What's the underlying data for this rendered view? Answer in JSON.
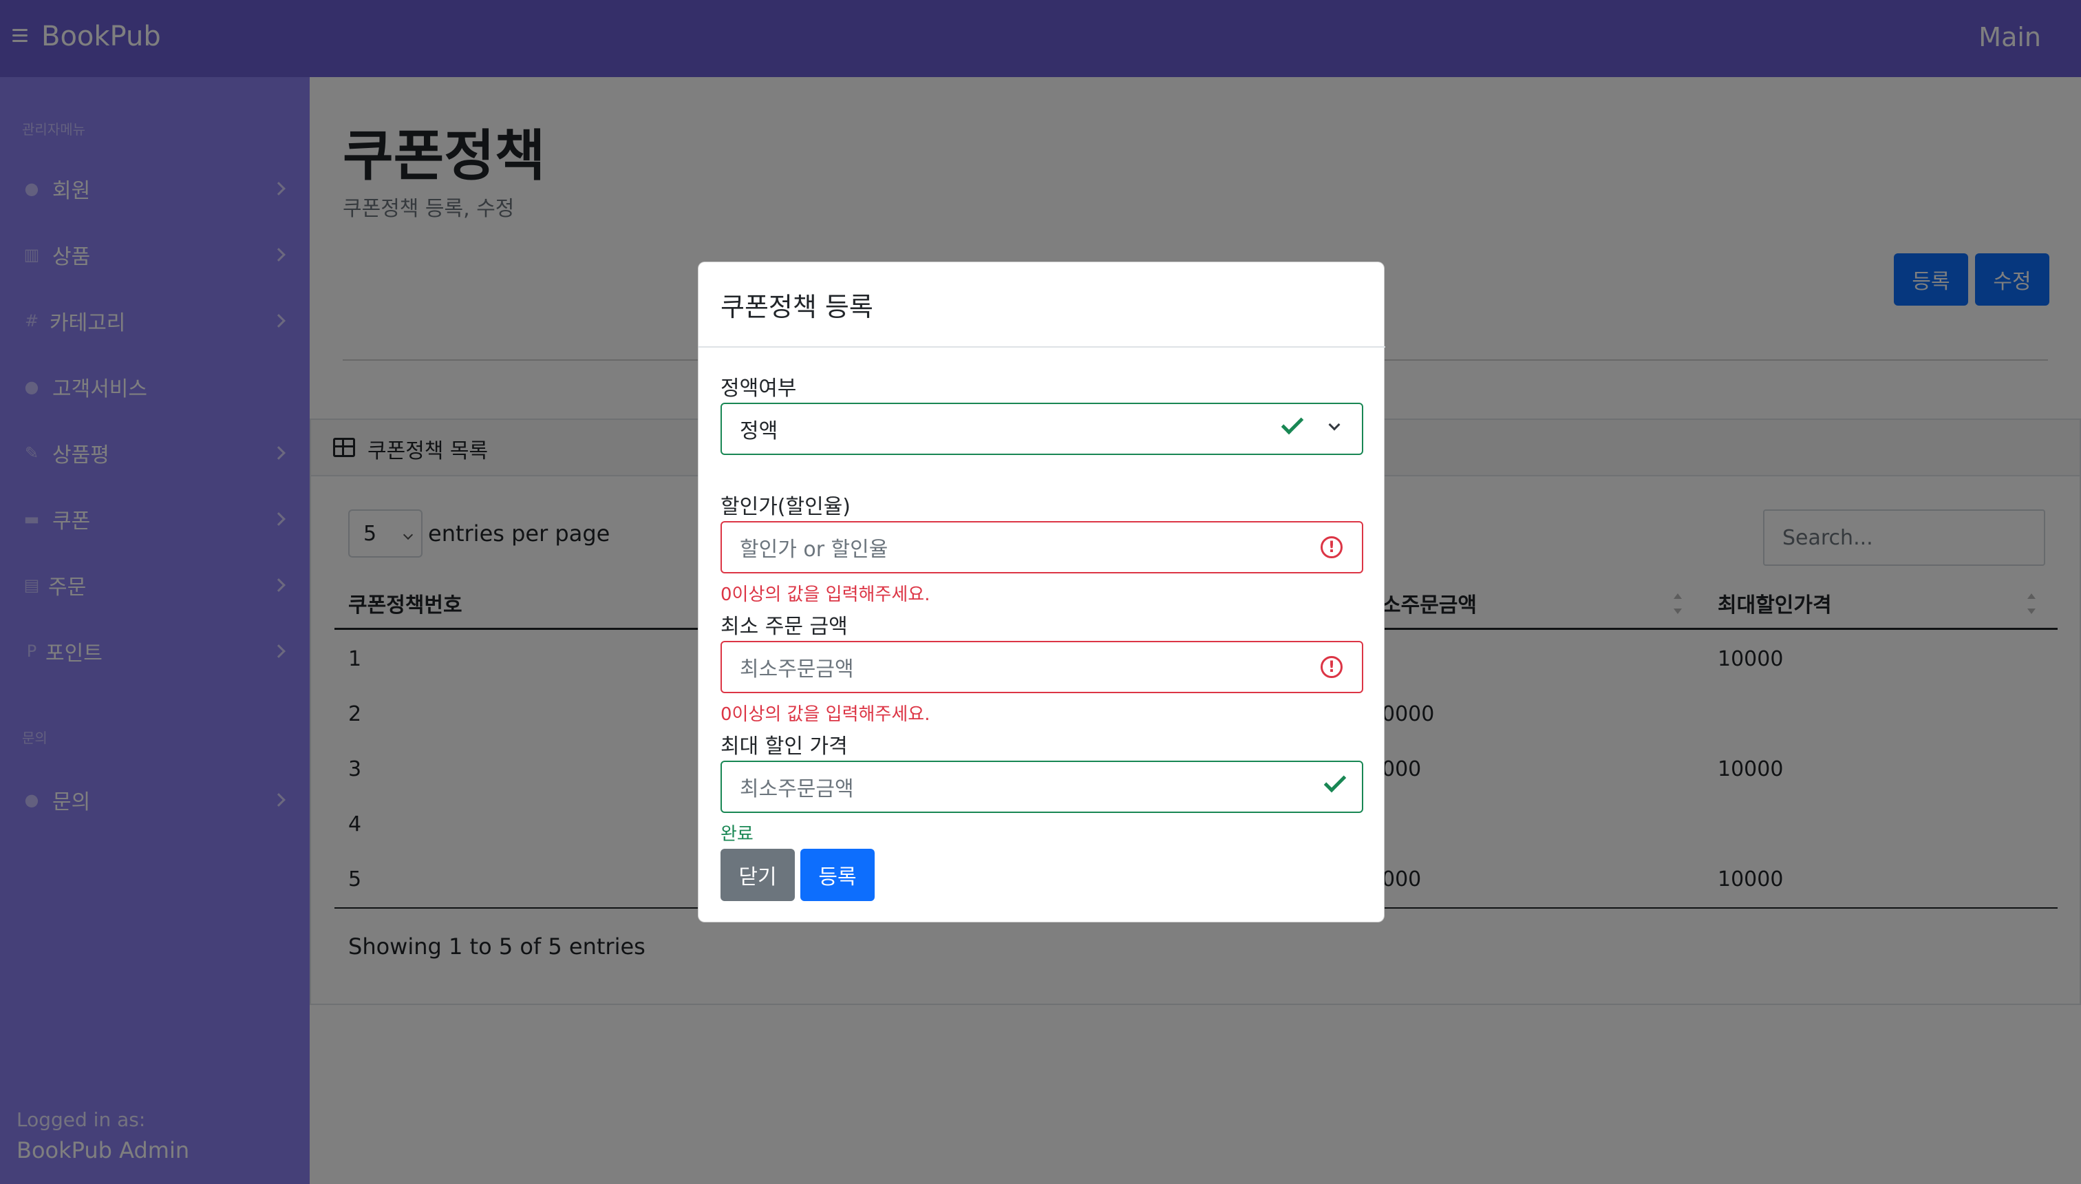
{
  "navbar": {
    "brand": "BookPub",
    "main_link": "Main"
  },
  "sidebar": {
    "section1": "관리자메뉴",
    "items": [
      {
        "label": "회원",
        "icon": "user-circle-icon"
      },
      {
        "label": "상품",
        "icon": "book-open-icon"
      },
      {
        "label": "카테고리",
        "icon": "hashtag-icon"
      },
      {
        "label": "고객서비스",
        "icon": "info-circle-icon"
      },
      {
        "label": "상품평",
        "icon": "edit-icon"
      },
      {
        "label": "쿠폰",
        "icon": "credit-card-icon"
      },
      {
        "label": "주문",
        "icon": "clipboard-icon"
      },
      {
        "label": "포인트",
        "icon": "p-letter-icon"
      }
    ],
    "section2": "문의",
    "items2": [
      {
        "label": "문의",
        "icon": "question-circle-icon"
      }
    ],
    "logged_in_label": "Logged in as:",
    "logged_in_name": "BookPub Admin"
  },
  "page": {
    "title": "쿠폰정책",
    "subtitle": "쿠폰정책 등록, 수정",
    "register_button": "등록",
    "edit_button": "수정"
  },
  "card": {
    "title": "쿠폰정책 목록",
    "per_page_value": "5",
    "per_page_label": "entries per page",
    "search_placeholder": "Search...",
    "columns": [
      "쿠폰정책번호",
      "소주문금액",
      "최대할인가격"
    ],
    "rows": [
      {
        "id": "1",
        "min": "",
        "max": "10000"
      },
      {
        "id": "2",
        "min": "0000",
        "max": ""
      },
      {
        "id": "3",
        "min": "000",
        "max": "10000"
      },
      {
        "id": "4",
        "min": "",
        "max": ""
      },
      {
        "id": "5",
        "min": "000",
        "max": "10000"
      }
    ],
    "showing": "Showing 1 to 5 of 5 entries"
  },
  "modal": {
    "title": "쿠폰정책 등록",
    "field1_label": "정액여부",
    "field1_value": "정액",
    "field2_label": "할인가(할인율)",
    "field2_placeholder": "할인가 or 할인율",
    "field2_error": "0이상의 값을 입력해주세요.",
    "field3_label": "최소 주문 금액",
    "field3_placeholder": "최소주문금액",
    "field3_error": "0이상의 값을 입력해주세요.",
    "field4_label": "최대 할인 가격",
    "field4_placeholder": "최소주문금액",
    "field4_valid": "완료",
    "close_button": "닫기",
    "submit_button": "등록"
  },
  "colors": {
    "primary": "#0d6efd",
    "sidebar": "#8a80f0",
    "navbar": "#6a5fd3",
    "valid": "#198754",
    "invalid": "#dc3545",
    "secondary": "#6c757d"
  }
}
